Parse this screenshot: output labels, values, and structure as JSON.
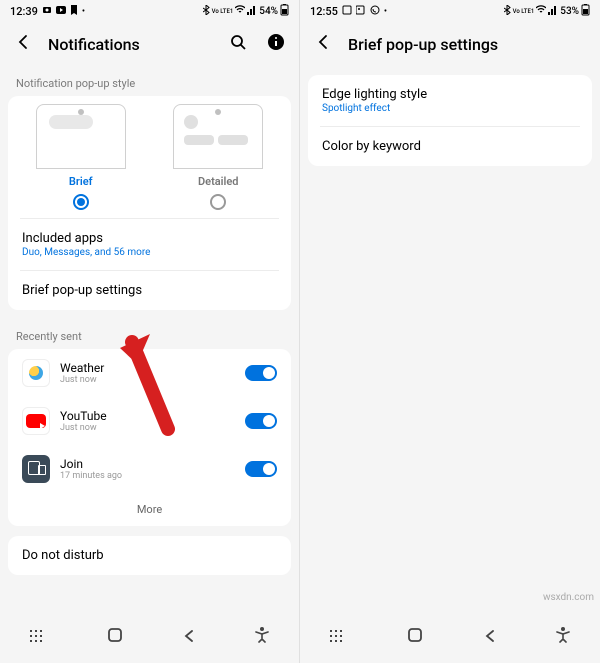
{
  "leftPhone": {
    "status": {
      "time": "12:39",
      "battery": "54%",
      "signal": "Vo LTE1"
    },
    "header": {
      "title": "Notifications"
    },
    "popupStyleSection": {
      "label": "Notification pop-up style",
      "options": [
        {
          "label": "Brief",
          "selected": true
        },
        {
          "label": "Detailed",
          "selected": false
        }
      ]
    },
    "includedApps": {
      "title": "Included apps",
      "sub": "Duo, Messages, and 56 more"
    },
    "briefPopup": {
      "title": "Brief pop-up settings"
    },
    "recentlySent": {
      "label": "Recently sent",
      "items": [
        {
          "name": "Weather",
          "time": "Just now",
          "icon": "weather"
        },
        {
          "name": "YouTube",
          "time": "Just now",
          "icon": "youtube"
        },
        {
          "name": "Join",
          "time": "17 minutes ago",
          "icon": "join"
        }
      ],
      "more": "More"
    },
    "dnd": {
      "title": "Do not disturb"
    }
  },
  "rightPhone": {
    "status": {
      "time": "12:55",
      "battery": "53%",
      "signal": "Vo LTE1"
    },
    "header": {
      "title": "Brief pop-up settings"
    },
    "items": [
      {
        "title": "Edge lighting style",
        "sub": "Spotlight effect"
      },
      {
        "title": "Color by keyword"
      }
    ]
  },
  "watermark": "wsxdn.com"
}
